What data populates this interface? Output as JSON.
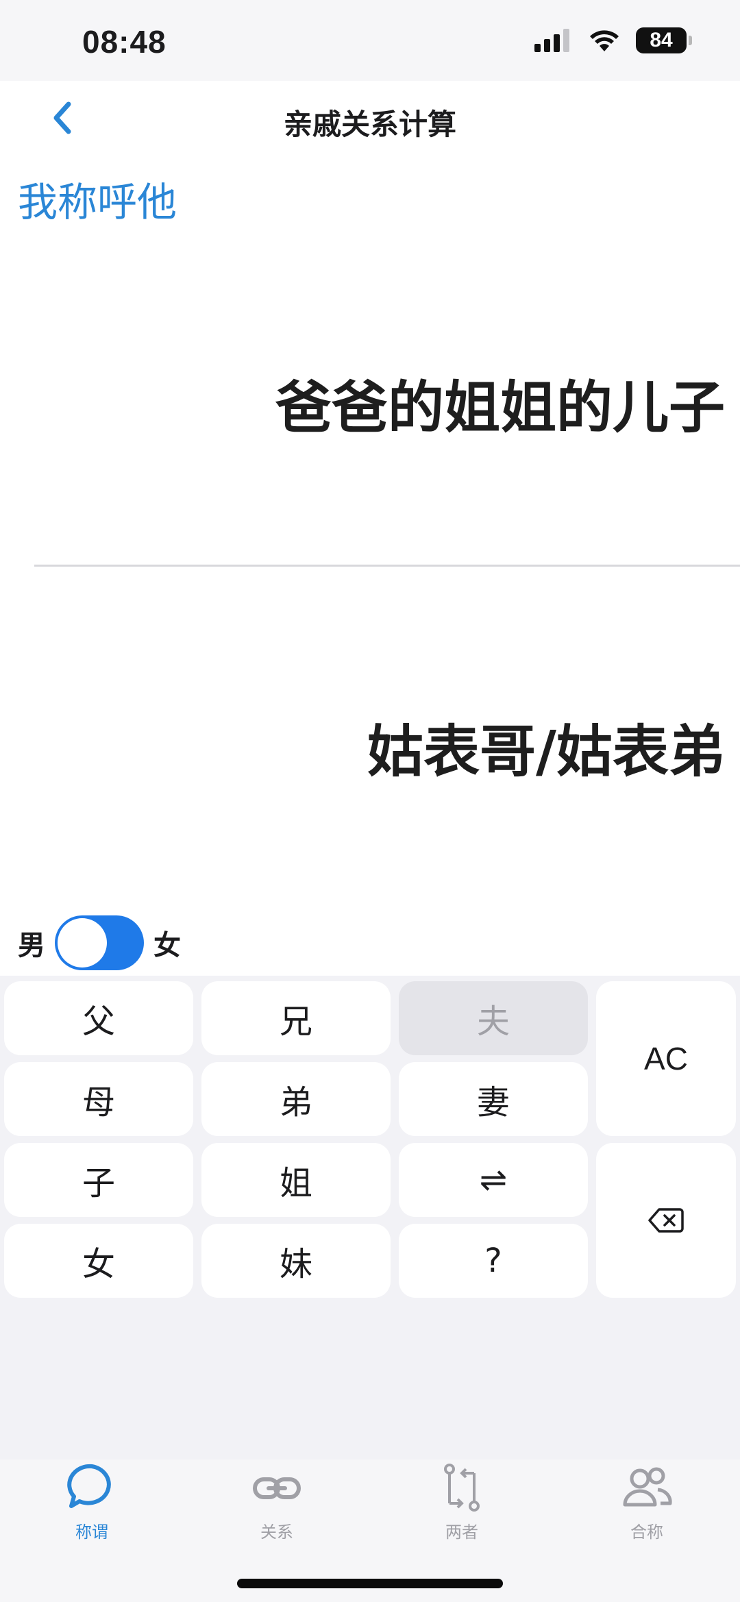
{
  "status_bar": {
    "time": "08:48",
    "battery": "84",
    "icons": [
      "signal-icon",
      "wifi-icon",
      "battery-icon"
    ]
  },
  "nav": {
    "title": "亲戚关系计算",
    "back_icon": "chevron-left-icon"
  },
  "call_label": "我称呼他",
  "relation_input": "爸爸的姐姐的儿子",
  "result": "姑表哥/姑表弟",
  "gender": {
    "male_label": "男",
    "female_label": "女",
    "selected": "男"
  },
  "keypad": {
    "keys": {
      "father": "父",
      "elder_brother": "兄",
      "husband": "夫",
      "clear": "AC",
      "mother": "母",
      "younger_brother": "弟",
      "wife": "妻",
      "son": "子",
      "elder_sister": "姐",
      "swap": "⇌",
      "daughter": "女",
      "younger_sister": "妹",
      "question": "?"
    },
    "backspace_icon": "backspace-icon"
  },
  "tabs": [
    {
      "label": "称谓",
      "icon": "chat-bubble-icon",
      "active": true
    },
    {
      "label": "关系",
      "icon": "link-icon",
      "active": false
    },
    {
      "label": "两者",
      "icon": "compare-icon",
      "active": false
    },
    {
      "label": "合称",
      "icon": "people-icon",
      "active": false
    }
  ],
  "colors": {
    "accent": "#2a86d6",
    "toggle": "#1f7ae8",
    "keypad_bg": "#f2f2f6",
    "inactive_tab": "#a0a0a6"
  }
}
